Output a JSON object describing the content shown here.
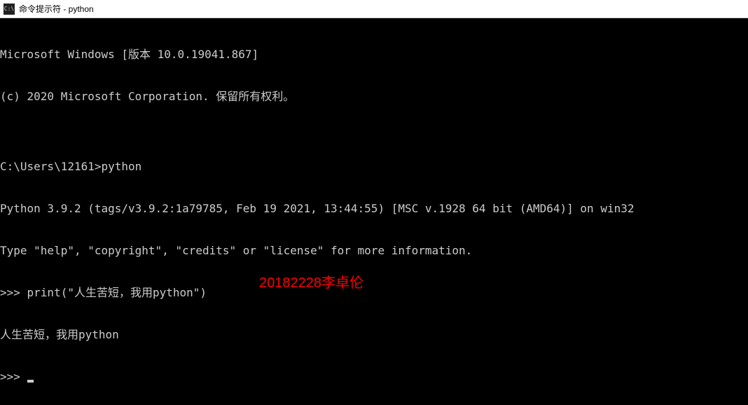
{
  "title_bar": {
    "icon_text": "C:\\",
    "title": "命令提示符 - python"
  },
  "terminal": {
    "lines": [
      "Microsoft Windows [版本 10.0.19041.867]",
      "(c) 2020 Microsoft Corporation. 保留所有权利。",
      "",
      "C:\\Users\\12161>python",
      "Python 3.9.2 (tags/v3.9.2:1a79785, Feb 19 2021, 13:44:55) [MSC v.1928 64 bit (AMD64)] on win32",
      "Type \"help\", \"copyright\", \"credits\" or \"license\" for more information.",
      ">>> print(\"人生苦短，我用python\")",
      "人生苦短，我用python",
      ">>> "
    ]
  },
  "watermark": {
    "text": "20182228李卓伦"
  }
}
